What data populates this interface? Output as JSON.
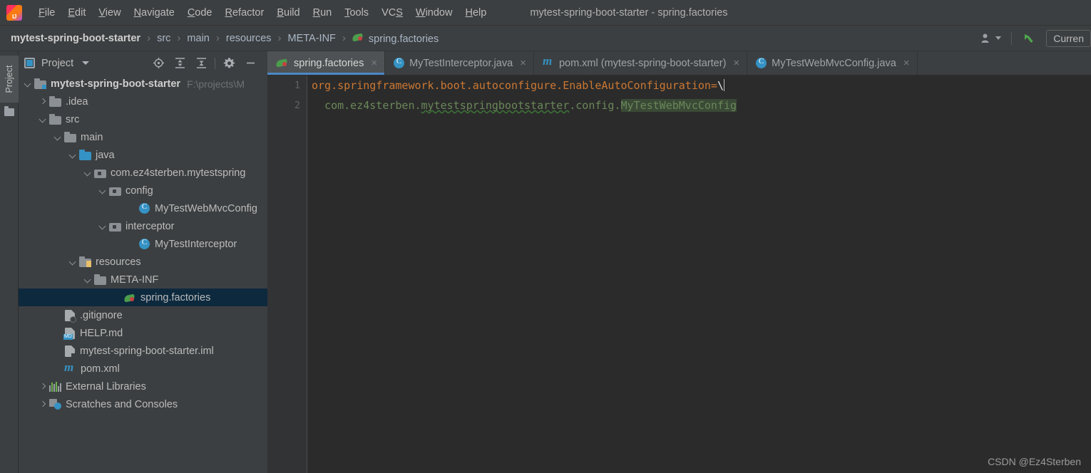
{
  "window": {
    "title": "mytest-spring-boot-starter - spring.factories",
    "logo_icon": "intellij-idea-logo"
  },
  "menubar": {
    "items": [
      {
        "label": "File",
        "mnemonic": "F"
      },
      {
        "label": "Edit",
        "mnemonic": "E"
      },
      {
        "label": "View",
        "mnemonic": "V"
      },
      {
        "label": "Navigate",
        "mnemonic": "N"
      },
      {
        "label": "Code",
        "mnemonic": "C"
      },
      {
        "label": "Refactor",
        "mnemonic": "R"
      },
      {
        "label": "Build",
        "mnemonic": "B"
      },
      {
        "label": "Run",
        "mnemonic": "R"
      },
      {
        "label": "Tools",
        "mnemonic": "T"
      },
      {
        "label": "VCS",
        "mnemonic": "S"
      },
      {
        "label": "Window",
        "mnemonic": "W"
      },
      {
        "label": "Help",
        "mnemonic": "H"
      }
    ]
  },
  "navbar": {
    "crumbs": [
      {
        "label": "mytest-spring-boot-starter",
        "icon": "none"
      },
      {
        "label": "src",
        "icon": "none"
      },
      {
        "label": "main",
        "icon": "none"
      },
      {
        "label": "resources",
        "icon": "none"
      },
      {
        "label": "META-INF",
        "icon": "none"
      },
      {
        "label": "spring.factories",
        "icon": "spring-leaf-icon"
      }
    ],
    "separator": "›",
    "right": {
      "user_icon": "user-dropdown-icon",
      "updates_icon": "green-arrow-icon",
      "run_config_label": "Curren"
    }
  },
  "left_stripe": {
    "project_tab_label": "Project",
    "folder_icon": "folder-icon"
  },
  "project_panel": {
    "toolbar": {
      "title": "Project",
      "window_icon": "project-window-icon",
      "dropdown_icon": "chevron-down-icon",
      "buttons": [
        {
          "name": "locate-icon",
          "glyph": "target"
        },
        {
          "name": "expand-all-icon",
          "glyph": "expand"
        },
        {
          "name": "collapse-all-icon",
          "glyph": "collapse"
        },
        {
          "name": "settings-gear-icon",
          "glyph": "gear"
        },
        {
          "name": "hide-panel-icon",
          "glyph": "minus"
        }
      ]
    },
    "tree": [
      {
        "label": "mytest-spring-boot-starter",
        "path": "F:\\projects\\M",
        "icon": "module-folder-icon",
        "indent": 0,
        "arrow": "down",
        "bold": true,
        "selected": false
      },
      {
        "label": ".idea",
        "path": "",
        "icon": "folder-icon",
        "indent": 1,
        "arrow": "right",
        "bold": false,
        "selected": false
      },
      {
        "label": "src",
        "path": "",
        "icon": "folder-icon",
        "indent": 1,
        "arrow": "down",
        "bold": false,
        "selected": false
      },
      {
        "label": "main",
        "path": "",
        "icon": "folder-icon",
        "indent": 2,
        "arrow": "down",
        "bold": false,
        "selected": false
      },
      {
        "label": "java",
        "path": "",
        "icon": "source-folder-icon",
        "indent": 3,
        "arrow": "down",
        "bold": false,
        "selected": false
      },
      {
        "label": "com.ez4sterben.mytestspring",
        "path": "",
        "icon": "package-icon",
        "indent": 4,
        "arrow": "down",
        "bold": false,
        "selected": false
      },
      {
        "label": "config",
        "path": "",
        "icon": "package-icon",
        "indent": 5,
        "arrow": "down",
        "bold": false,
        "selected": false
      },
      {
        "label": "MyTestWebMvcConfig",
        "path": "",
        "icon": "java-class-icon",
        "indent": 7,
        "arrow": "none",
        "bold": false,
        "selected": false
      },
      {
        "label": "interceptor",
        "path": "",
        "icon": "package-icon",
        "indent": 5,
        "arrow": "down",
        "bold": false,
        "selected": false
      },
      {
        "label": "MyTestInterceptor",
        "path": "",
        "icon": "java-class-icon",
        "indent": 7,
        "arrow": "none",
        "bold": false,
        "selected": false
      },
      {
        "label": "resources",
        "path": "",
        "icon": "resources-folder-icon",
        "indent": 3,
        "arrow": "down",
        "bold": false,
        "selected": false
      },
      {
        "label": "META-INF",
        "path": "",
        "icon": "folder-icon",
        "indent": 4,
        "arrow": "down",
        "bold": false,
        "selected": false
      },
      {
        "label": "spring.factories",
        "path": "",
        "icon": "spring-leaf-icon",
        "indent": 6,
        "arrow": "none",
        "bold": false,
        "selected": true
      },
      {
        "label": ".gitignore",
        "path": "",
        "icon": "gitignore-file-icon",
        "indent": 2,
        "arrow": "none",
        "bold": false,
        "selected": false
      },
      {
        "label": "HELP.md",
        "path": "",
        "icon": "markdown-file-icon",
        "indent": 2,
        "arrow": "none",
        "bold": false,
        "selected": false
      },
      {
        "label": "mytest-spring-boot-starter.iml",
        "path": "",
        "icon": "iml-file-icon",
        "indent": 2,
        "arrow": "none",
        "bold": false,
        "selected": false
      },
      {
        "label": "pom.xml",
        "path": "",
        "icon": "maven-pom-icon",
        "indent": 2,
        "arrow": "none",
        "bold": false,
        "selected": false
      },
      {
        "label": "External Libraries",
        "path": "",
        "icon": "libraries-icon",
        "indent": 1,
        "arrow": "right",
        "bold": false,
        "selected": false
      },
      {
        "label": "Scratches and Consoles",
        "path": "",
        "icon": "scratches-icon",
        "indent": 1,
        "arrow": "right",
        "bold": false,
        "selected": false
      }
    ]
  },
  "editor": {
    "tabs": [
      {
        "label": "spring.factories",
        "icon": "spring-leaf-icon",
        "active": true,
        "close": "×"
      },
      {
        "label": "MyTestInterceptor.java",
        "icon": "java-class-icon",
        "active": false,
        "close": "×"
      },
      {
        "label": "pom.xml (mytest-spring-boot-starter)",
        "icon": "maven-pom-icon",
        "active": false,
        "close": "×"
      },
      {
        "label": "MyTestWebMvcConfig.java",
        "icon": "java-class-icon",
        "active": false,
        "close": "×"
      }
    ],
    "line_numbers": [
      "1",
      "2"
    ],
    "lines": [
      {
        "n": "1",
        "tokens": [
          {
            "text": "org.springframework.boot.autoconfigure.EnableAutoConfiguration=",
            "style": "orange"
          },
          {
            "text": "\\",
            "style": "white"
          }
        ]
      },
      {
        "n": "2",
        "tokens": [
          {
            "text": "  com.ez4sterben.",
            "style": "green"
          },
          {
            "text": "mytestspringbootstarter",
            "style": "green-typo"
          },
          {
            "text": ".config.",
            "style": "green"
          },
          {
            "text": "MyTestWebMvcConfig",
            "style": "green-highlight"
          }
        ]
      }
    ]
  },
  "watermark": "CSDN @Ez4Sterben",
  "colors": {
    "chrome_bg": "#3c3f41",
    "editor_bg": "#2b2b2b",
    "gutter_bg": "#313335",
    "selection_bg": "#0d293e",
    "active_tab_bg": "#4e5254",
    "accent_blue": "#4a88c7",
    "string_orange": "#cc7832",
    "comment_green": "#6a8759",
    "icon_blue": "#3592c4"
  }
}
